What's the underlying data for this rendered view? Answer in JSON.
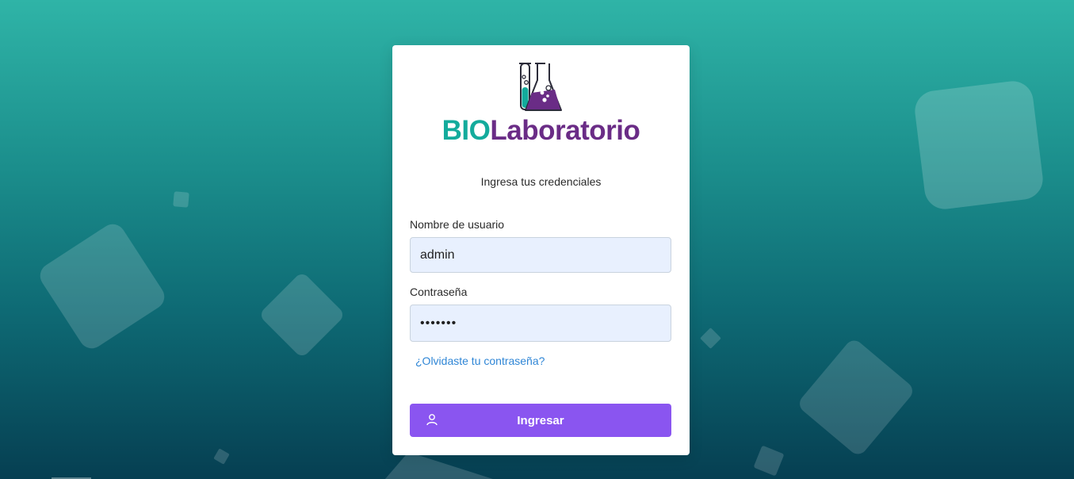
{
  "brand": {
    "name_part1": "BIO",
    "name_part2": "Laboratorio",
    "colors": {
      "teal": "#13ab9c",
      "purple": "#6a2c86"
    },
    "icon": "lab-flask-icon"
  },
  "login": {
    "subtitle": "Ingresa tus credenciales",
    "username_label": "Nombre de usuario",
    "username_value": "admin",
    "password_label": "Contraseña",
    "password_value": "•••••••",
    "forgot_link": "¿Olvidaste tu contraseña?",
    "submit_label": "Ingresar",
    "submit_icon": "user-icon",
    "accent_color": "#8a55f0"
  }
}
